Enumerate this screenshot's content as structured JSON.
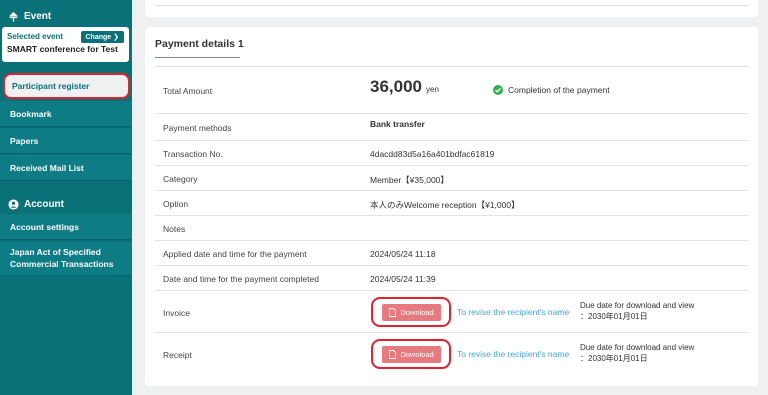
{
  "sidebar": {
    "event_header": "Event",
    "selected_event_label": "Selected event",
    "change_button": "Change",
    "event_name": "SMART conference for Test",
    "nav": [
      "Participant register",
      "Bookmark",
      "Papers",
      "Received Mail List"
    ],
    "account_header": "Account",
    "account_nav": [
      "Account settings",
      "Japan Act of Specified Commercial Transactions"
    ]
  },
  "payment": {
    "title": "Payment details 1",
    "rows": {
      "total_label": "Total Amount",
      "total_value": "36,000",
      "total_unit": "yen",
      "status": "Completion of the payment",
      "method_label": "Payment methods",
      "method_value": "Bank transfer",
      "txn_label": "Transaction No.",
      "txn_value": "4dacdd83d5a16a401bdfac61819",
      "category_label": "Category",
      "category_value": "Member【¥35,000】",
      "option_label": "Option",
      "option_value": "本人のみWelcome reception【¥1,000】",
      "notes_label": "Notes",
      "applied_label": "Applied date and time for the payment",
      "applied_value": "2024/05/24 11:18",
      "completed_label": "Date and time for the payment completed",
      "completed_value": "2024/05/24 11:39",
      "invoice_label": "Invoice",
      "receipt_label": "Receipt",
      "download_label": "Download",
      "revise_link": "To revise the recipient's name",
      "due_line1": "Due date for download and view",
      "due_line2": "：2030年01月01日"
    }
  },
  "colors": {
    "sidebar": "#0b7178",
    "accent_red": "#e3212f",
    "download_btn": "#e77a7f",
    "link": "#4aa6d8",
    "check": "#2db34a"
  }
}
